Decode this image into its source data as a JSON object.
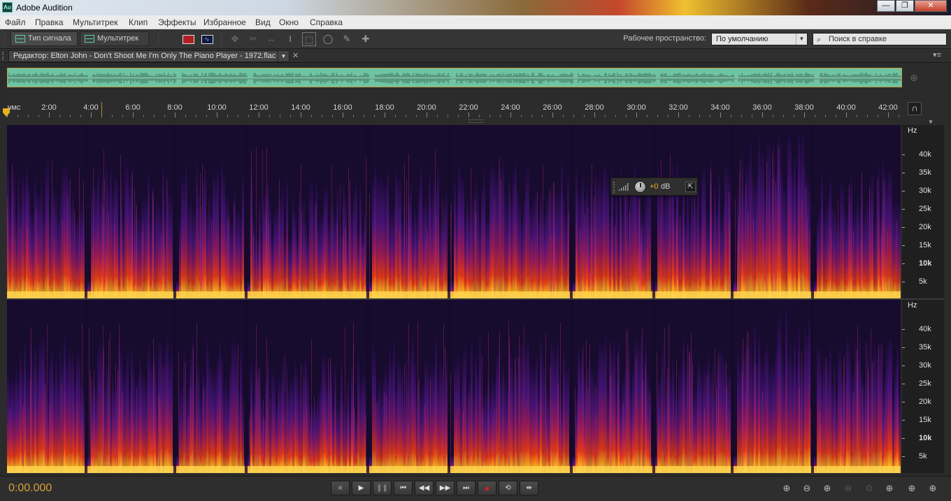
{
  "window": {
    "app_icon": "Au",
    "title": "Adobe Audition"
  },
  "menu": [
    "Файл",
    "Правка",
    "Мультитрек",
    "Клип",
    "Эффекты",
    "Избранное",
    "Вид",
    "Окно",
    "Справка"
  ],
  "toolbar": {
    "waveform_label": "Тип сигнала",
    "multitrack_label": "Мультитрек",
    "workspace_label": "Рабочее пространство:",
    "workspace_value": "По умолчанию",
    "help_search_placeholder": "Поиск в справке"
  },
  "editor": {
    "tab_label": "Редактор: Elton John - Don't Shoot Me I'm Only The Piano Player - 1972.flac"
  },
  "ruler": {
    "unit_label": "чмс",
    "labels": [
      "2:00",
      "4:00",
      "6:00",
      "8:00",
      "10:00",
      "12:00",
      "14:00",
      "16:00",
      "18:00",
      "20:00",
      "22:00",
      "24:00",
      "26:00",
      "28:00",
      "30:00",
      "32:00",
      "34:00",
      "36:00",
      "38:00",
      "40:00",
      "42:00"
    ]
  },
  "frequency_scale": {
    "header": "Hz",
    "labels": [
      {
        "text": "40k",
        "bold": false
      },
      {
        "text": "35k",
        "bold": false
      },
      {
        "text": "30k",
        "bold": false
      },
      {
        "text": "25k",
        "bold": false
      },
      {
        "text": "20k",
        "bold": false
      },
      {
        "text": "15k",
        "bold": false
      },
      {
        "text": "10k",
        "bold": true
      },
      {
        "text": "5k",
        "bold": false
      }
    ]
  },
  "hud": {
    "volume_value": "+0",
    "volume_unit": "dB"
  },
  "transport": {
    "time": "0:00.000"
  },
  "colors": {
    "accent_time": "#d7a23a",
    "overview_waveform": "#6fc4a3",
    "spectral_low": "#150a2a",
    "spectral_high": "#ffd24a"
  }
}
